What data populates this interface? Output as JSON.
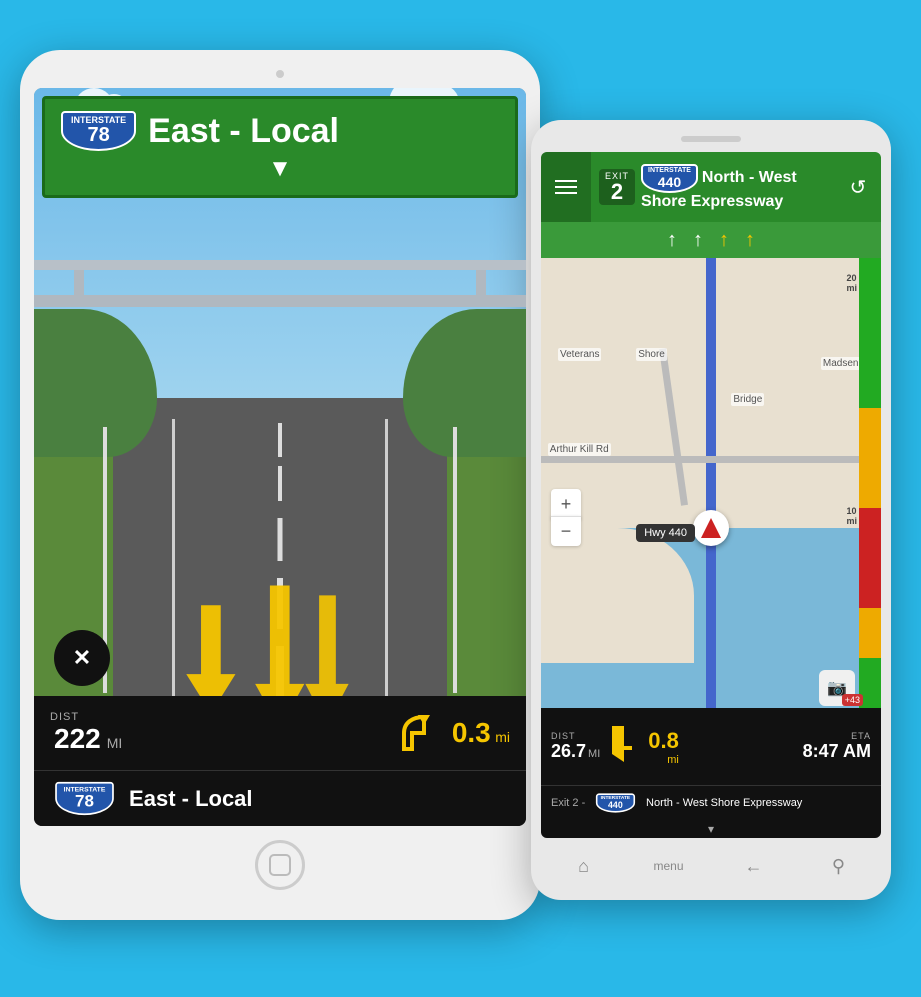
{
  "tablet": {
    "sign": {
      "shield_number": "78",
      "direction": "East - Local",
      "arrow": "▼"
    },
    "bottom_bar": {
      "dist_label": "DIST",
      "dist_value": "222",
      "dist_unit": "MI",
      "next_dist": "0.3",
      "next_dist_unit": "mi",
      "route_shield": "78",
      "route_text": "East - Local"
    },
    "close_btn": "✕"
  },
  "phone": {
    "header": {
      "exit_label": "EXIT",
      "exit_num": "2",
      "shield_num": "440",
      "route_line1": "North - West",
      "route_line2": "Shore Expressway"
    },
    "lanes": [
      "↑",
      "↑",
      "↑",
      "↑"
    ],
    "map": {
      "tooltip": "Hwy 440",
      "label_road1": "Arthur Kill Rd",
      "label_road2": "Bridge",
      "label_road3": "Shore",
      "label_road4": "Madsen Av"
    },
    "traffic": {
      "label_top": "20 mi",
      "label_mid": "10 mi"
    },
    "bottom_bar": {
      "dist_label": "DIST",
      "dist_value": "26.7",
      "dist_unit": "MI",
      "next_dist": "0.8",
      "next_dist_unit": "mi",
      "eta_label": "ETA",
      "eta_value": "8:47 AM",
      "route_prefix": "Exit 2 -",
      "route_shield": "440",
      "route_desc": "North - West Shore Expressway"
    },
    "zoom_plus": "+",
    "zoom_minus": "−",
    "notification": "+43",
    "nav_buttons": [
      "⌂",
      "menu",
      "←",
      "⚲"
    ]
  }
}
